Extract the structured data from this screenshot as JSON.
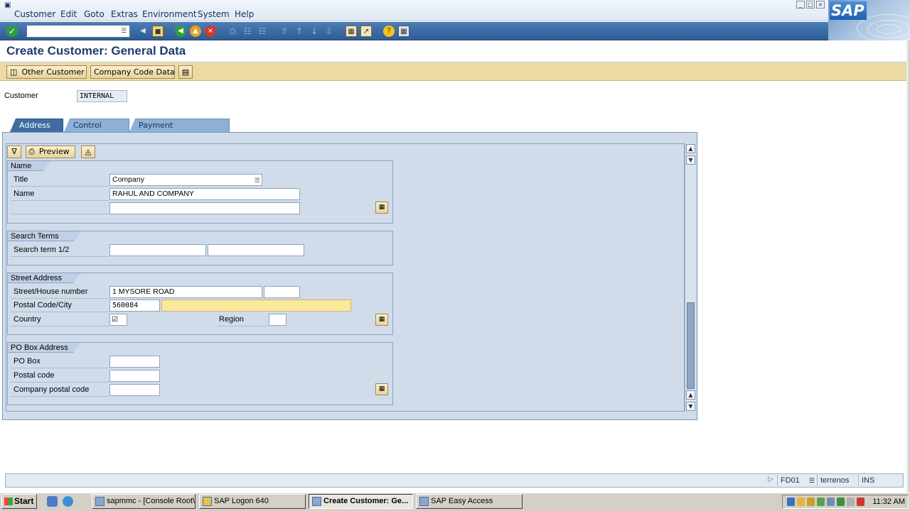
{
  "menubar": {
    "items": [
      {
        "label": "Customer"
      },
      {
        "label": "Edit"
      },
      {
        "label": "Goto"
      },
      {
        "label": "Extras"
      },
      {
        "label": "Environment"
      },
      {
        "label": "System"
      },
      {
        "label": "Help"
      }
    ],
    "logo": "SAP"
  },
  "toolbar": {
    "command_field_value": "",
    "icons": [
      "enter-icon",
      "back-arrow-icon",
      "save-icon",
      "back-icon",
      "exit-icon",
      "cancel-icon",
      "print-icon",
      "find-icon",
      "find-next-icon",
      "first-page-icon",
      "previous-page-icon",
      "next-page-icon",
      "last-page-icon",
      "create-session-icon",
      "shortcut-icon",
      "help-icon",
      "layout-menu-icon"
    ]
  },
  "page": {
    "title": "Create Customer: General Data"
  },
  "app_toolbar": {
    "other_customer": "Other Customer",
    "company_code_data": "Company Code Data"
  },
  "header": {
    "customer_label": "Customer",
    "customer_value": "INTERNAL"
  },
  "tabs": [
    {
      "label": "Address",
      "active": true
    },
    {
      "label": "Control Data",
      "active": false
    },
    {
      "label": "Payment Transactions",
      "active": false
    }
  ],
  "inner_toolbar": {
    "preview_label": "Preview"
  },
  "groups": {
    "name": {
      "title": "Name",
      "title_label": "Title",
      "title_value": "Company",
      "name_label": "Name",
      "name_value": "RAHUL AND COMPANY",
      "name2_value": ""
    },
    "search_terms": {
      "title": "Search Terms",
      "label": "Search term 1/2",
      "term1": "",
      "term2": ""
    },
    "street_address": {
      "title": "Street Address",
      "street_label": "Street/House number",
      "street_value": "1 MYSORE ROAD",
      "house_number": "",
      "postal_city_label": "Postal Code/City",
      "postal_value": "560084",
      "city_value": "",
      "country_label": "Country",
      "country_value": "",
      "region_label": "Region",
      "region_value": ""
    },
    "po_box": {
      "title": "PO Box Address",
      "po_box_label": "PO Box",
      "postal_code_label": "Postal code",
      "company_postal_code_label": "Company postal code"
    }
  },
  "statusbar": {
    "transaction": "FD01",
    "server": "terrenos",
    "mode": "INS"
  },
  "taskbar": {
    "start": "Start",
    "tasks": [
      {
        "label": "sapmmc - [Console Root\\..."
      },
      {
        "label": "SAP Logon 640"
      },
      {
        "label": "Create Customer: Ge...",
        "active": true
      },
      {
        "label": "SAP Easy Access"
      }
    ],
    "clock": "11:32 AM"
  }
}
